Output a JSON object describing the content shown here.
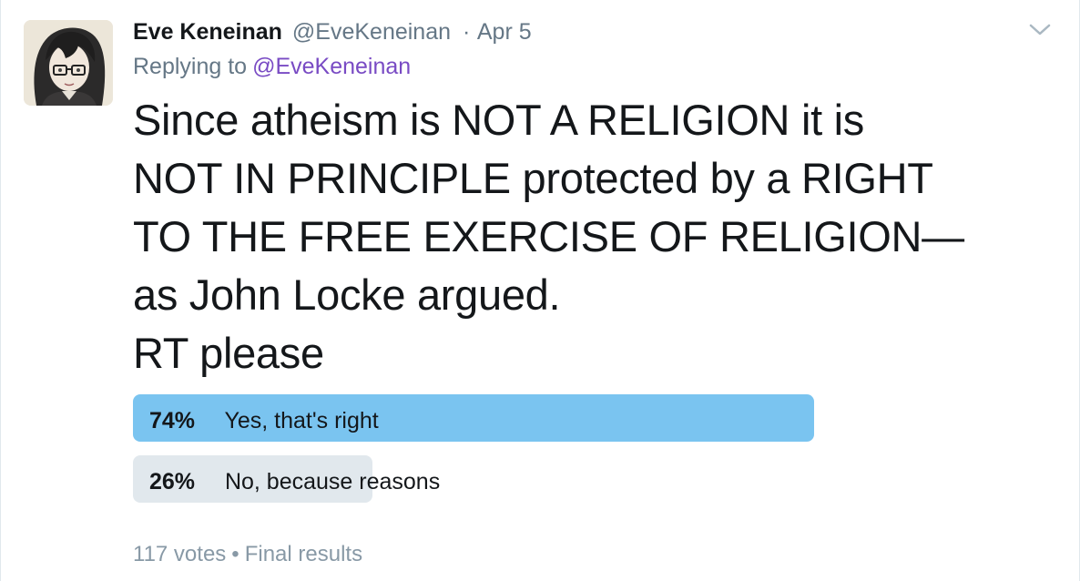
{
  "author": {
    "display_name": "Eve Keneinan",
    "handle": "@EveKeneinan",
    "separator": "·",
    "date": "Apr 5"
  },
  "reply": {
    "prefix": "Replying to",
    "target": "@EveKeneinan"
  },
  "tweet": {
    "lines": [
      "Since atheism is NOT A RELIGION it is",
      "NOT IN PRINCIPLE protected by a RIGHT",
      "TO THE FREE EXERCISE OF RELIGION—",
      "as John Locke argued.",
      "RT please"
    ]
  },
  "poll": {
    "options": [
      {
        "percent_label": "74%",
        "percent": 74,
        "label": "Yes, that's right",
        "winner": true
      },
      {
        "percent_label": "26%",
        "percent": 26,
        "label": "No, because reasons",
        "winner": false
      }
    ],
    "votes": "117 votes",
    "bullet": "•",
    "status": "Final results"
  },
  "icons": {
    "caret": "chevron-down-icon",
    "avatar": "profile-avatar"
  },
  "colors": {
    "winner_bar": "#7ac4f0",
    "loser_bar": "#e1e8ed",
    "link": "#794bc4",
    "secondary_text": "#657786"
  }
}
